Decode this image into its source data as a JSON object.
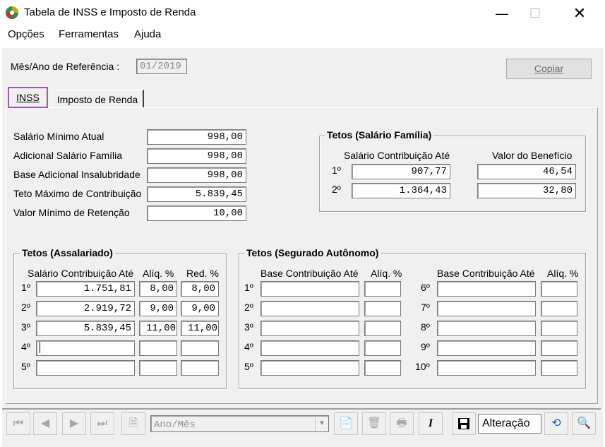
{
  "window": {
    "title": "Tabela de INSS e Imposto de Renda"
  },
  "menu": [
    "Opções",
    "Ferramentas",
    "Ajuda"
  ],
  "ref": {
    "label": "Mês/Ano de Referência :",
    "value": "01/2019"
  },
  "copy_button": "Copiar",
  "tabs": [
    "INSS",
    "Imposto de Renda"
  ],
  "params": [
    {
      "label": "Salário Mínimo Atual",
      "value": "998,00"
    },
    {
      "label": "Adicional Salário Família",
      "value": "998,00"
    },
    {
      "label": "Base Adicional Insalubridade",
      "value": "998,00"
    },
    {
      "label": "Teto Máximo de Contribuição",
      "value": "5.839,45"
    },
    {
      "label": "Valor Mínimo de Retenção",
      "value": "10,00"
    }
  ],
  "familia": {
    "title": "Tetos (Salário Família)",
    "col1": "Salário Contribuição Até",
    "col2": "Valor do Benefício",
    "rows": [
      {
        "n": "1º",
        "ate": "907,77",
        "valor": "46,54"
      },
      {
        "n": "2º",
        "ate": "1.364,43",
        "valor": "32,80"
      }
    ]
  },
  "assalariado": {
    "title": "Tetos (Assalariado)",
    "col1": "Salário Contribuição Até",
    "col2": "Alíq. %",
    "col3": "Red. %",
    "rows": [
      {
        "n": "1º",
        "ate": "1.751,81",
        "aliq": "8,00",
        "red": "8,00"
      },
      {
        "n": "2º",
        "ate": "2.919,72",
        "aliq": "9,00",
        "red": "9,00"
      },
      {
        "n": "3º",
        "ate": "5.839,45",
        "aliq": "11,00",
        "red": "11,00"
      },
      {
        "n": "4º",
        "ate": "",
        "aliq": "",
        "red": ""
      },
      {
        "n": "5º",
        "ate": "",
        "aliq": "",
        "red": ""
      }
    ]
  },
  "autonomo": {
    "title": "Tetos (Segurado Autônomo)",
    "col1": "Base Contribuição Até",
    "col2": "Alíq. %",
    "left": [
      "1º",
      "2º",
      "3º",
      "4º",
      "5º"
    ],
    "right": [
      "6º",
      "7º",
      "8º",
      "9º",
      "10º"
    ]
  },
  "toolbar": {
    "search_placeholder": "Ano/Mês",
    "status": "Alteração"
  }
}
